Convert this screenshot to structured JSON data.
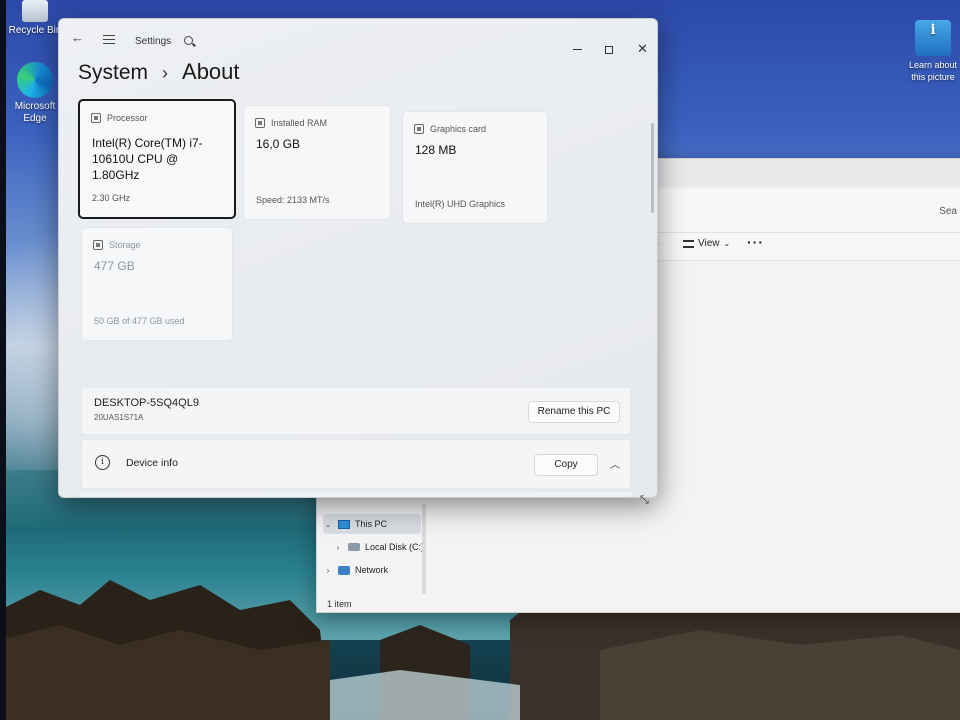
{
  "desktop": {
    "icons": {
      "recycle_bin": "Recycle Bin",
      "edge": "Microsoft Edge",
      "learn": "Learn about this picture"
    }
  },
  "settings": {
    "app_title": "Settings",
    "breadcrumb": {
      "parent": "System",
      "separator": "›",
      "current": "About"
    },
    "cards": {
      "processor": {
        "label": "Processor",
        "value": "Intel(R) Core(TM) i7-10610U CPU @ 1.80GHz",
        "footer": "2.30 GHz"
      },
      "ram": {
        "label": "Installed RAM",
        "value": "16,0 GB",
        "footer": "Speed: 2133 MT/s"
      },
      "graphics": {
        "label": "Graphics card",
        "value": "128 MB",
        "footer": "Intel(R) UHD Graphics"
      },
      "storage": {
        "label": "Storage",
        "value": "477 GB",
        "footer": "50 GB of 477 GB used"
      }
    },
    "pc": {
      "name": "DESKTOP-5SQ4QL9",
      "model": "20UAS1S71A",
      "rename_label": "Rename this PC"
    },
    "device_info": {
      "label": "Device info",
      "copy_label": "Copy"
    }
  },
  "explorer": {
    "search_label": "Sea",
    "view_label": "View",
    "more_label": "···",
    "nav": {
      "this_pc": "This PC",
      "local_disk": "Local Disk (C:)",
      "network": "Network"
    },
    "status": "1 item"
  },
  "colors": {
    "accent": "#1b1b1b",
    "card_bg": "#f6f7f8",
    "window_bg": "#eceef1"
  }
}
